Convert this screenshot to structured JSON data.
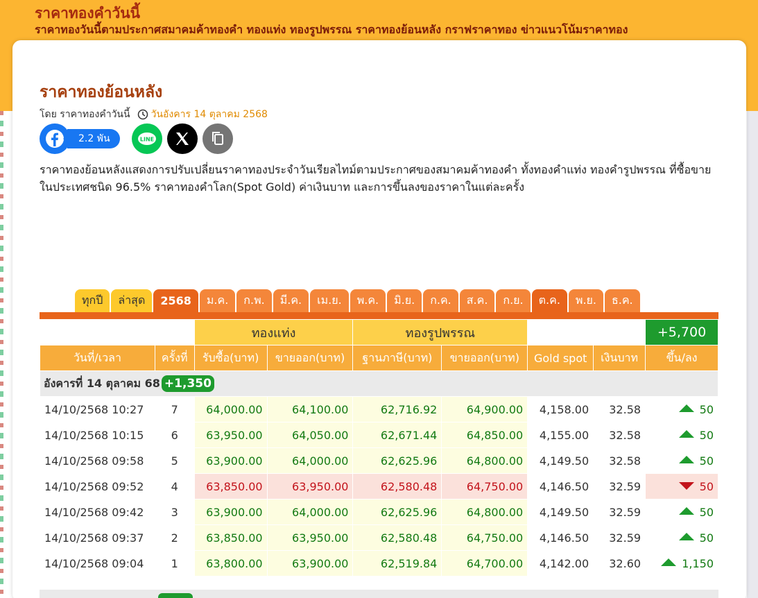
{
  "banner": {
    "title": "ราคาทองคำวันนี้",
    "subtitle": "ราคาทองวันนี้ตามประกาศสมาคมค้าทองคำ ทองแท่ง ทองรูปพรรณ ราคาทองย้อนหลัง กราฟราคาทอง ข่าวแนวโน้มราคาทอง"
  },
  "article": {
    "title": "ราคาทองย้อนหลัง",
    "by": "โดย ราคาทองคำวันนี้",
    "date": "วันอังคาร 14 ตุลาคม 2568",
    "description": "ราคาทองย้อนหลังแสดงการปรับเปลี่ยนราคาทองประจำวันเรียลไทม์ตามประกาศของสมาคมค้าทองคำ ทั้งทองคำแท่ง ทองคำรูปพรรณ ที่ซื้อขายในประเทศชนิด 96.5% ราคาทองคำโลก(Spot Gold) ค่าเงินบาท และการขึ้นลงของราคาในแต่ละครั้ง"
  },
  "share": {
    "facebook_count": "2.2 พัน",
    "icons": [
      "facebook-icon",
      "line-icon",
      "x-icon",
      "copy-icon"
    ]
  },
  "tabs": {
    "all_years": "ทุกปี",
    "latest": "ล่าสุด",
    "year": "2568",
    "months": [
      "ม.ค.",
      "ก.พ.",
      "มี.ค.",
      "เม.ย.",
      "พ.ค.",
      "มิ.ย.",
      "ก.ค.",
      "ส.ค.",
      "ก.ย.",
      "ต.ค.",
      "พ.ย.",
      "ธ.ค."
    ]
  },
  "table": {
    "group_bar": "ทองแท่ง",
    "group_ornament": "ทองรูปพรรณ",
    "total_change": "+5,700",
    "headers": [
      "วันที่/เวลา",
      "ครั้งที่",
      "รับซื้อ(บาท)",
      "ขายออก(บาท)",
      "ฐานภาษี(บาท)",
      "ขายออก(บาท)",
      "Gold spot",
      "เงินบาท",
      "ขึ้น/ลง"
    ],
    "day_label": "อังคารที่ 14 ตุลาคม 68",
    "day_change": "+1,350",
    "rows": [
      {
        "dt": "14/10/2568 10:27",
        "n": "7",
        "buy": "64,000.00",
        "sell": "64,100.00",
        "tax": "62,716.92",
        "osell": "64,900.00",
        "spot": "4,158.00",
        "thb": "32.58",
        "chg": "50",
        "dir": "up"
      },
      {
        "dt": "14/10/2568 10:15",
        "n": "6",
        "buy": "63,950.00",
        "sell": "64,050.00",
        "tax": "62,671.44",
        "osell": "64,850.00",
        "spot": "4,155.00",
        "thb": "32.58",
        "chg": "50",
        "dir": "up"
      },
      {
        "dt": "14/10/2568 09:58",
        "n": "5",
        "buy": "63,900.00",
        "sell": "64,000.00",
        "tax": "62,625.96",
        "osell": "64,800.00",
        "spot": "4,149.50",
        "thb": "32.58",
        "chg": "50",
        "dir": "up"
      },
      {
        "dt": "14/10/2568 09:52",
        "n": "4",
        "buy": "63,850.00",
        "sell": "63,950.00",
        "tax": "62,580.48",
        "osell": "64,750.00",
        "spot": "4,146.50",
        "thb": "32.59",
        "chg": "50",
        "dir": "down"
      },
      {
        "dt": "14/10/2568 09:42",
        "n": "3",
        "buy": "63,900.00",
        "sell": "64,000.00",
        "tax": "62,625.96",
        "osell": "64,800.00",
        "spot": "4,149.50",
        "thb": "32.59",
        "chg": "50",
        "dir": "up"
      },
      {
        "dt": "14/10/2568 09:37",
        "n": "2",
        "buy": "63,850.00",
        "sell": "63,950.00",
        "tax": "62,580.48",
        "osell": "64,750.00",
        "spot": "4,146.50",
        "thb": "32.59",
        "chg": "50",
        "dir": "up"
      },
      {
        "dt": "14/10/2568 09:04",
        "n": "1",
        "buy": "63,800.00",
        "sell": "63,900.00",
        "tax": "62,519.84",
        "osell": "64,700.00",
        "spot": "4,142.00",
        "thb": "32.60",
        "chg": "1,150",
        "dir": "up"
      }
    ]
  },
  "colors": {
    "banner": "#fcb531",
    "tab_active": "#e8641b",
    "up": "#1e9b2e",
    "down": "#c3141c"
  }
}
